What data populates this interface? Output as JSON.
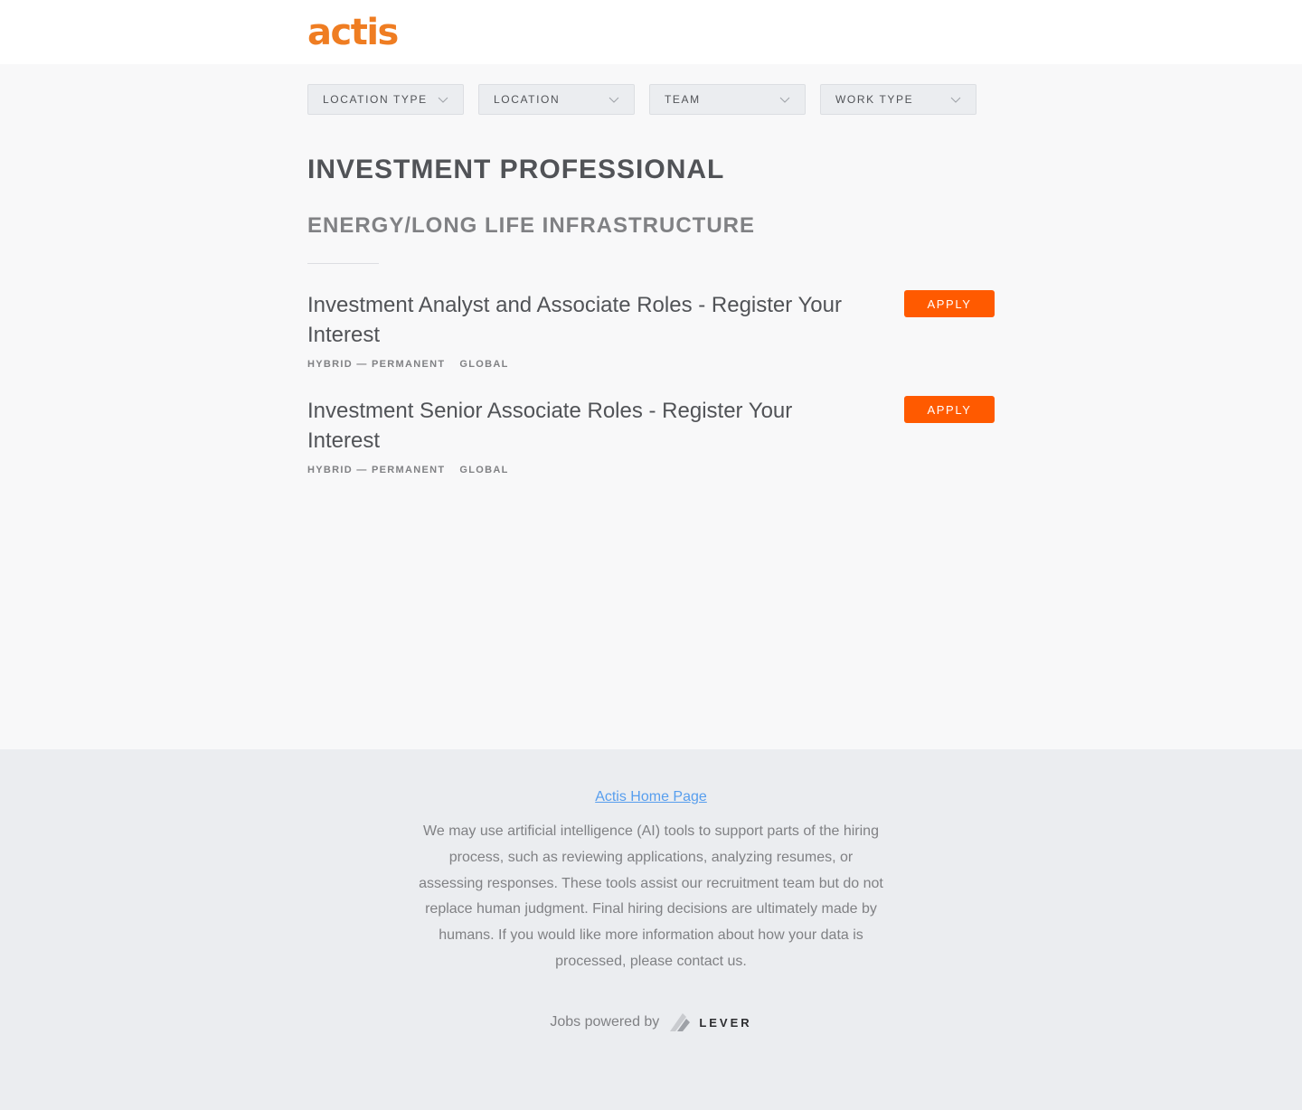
{
  "header": {
    "logo_text": "actis",
    "logo_color": "#ef7d22"
  },
  "filters": [
    {
      "label": "LOCATION TYPE"
    },
    {
      "label": "LOCATION"
    },
    {
      "label": "TEAM"
    },
    {
      "label": "WORK TYPE"
    }
  ],
  "department": "INVESTMENT PROFESSIONAL",
  "team": "ENERGY/LONG LIFE INFRASTRUCTURE",
  "postings": [
    {
      "title": "Investment Analyst and Associate Roles - Register Your Interest",
      "commitment": "HYBRID — PERMANENT",
      "location": "GLOBAL",
      "apply_label": "APPLY"
    },
    {
      "title": "Investment Senior Associate Roles - Register Your Interest",
      "commitment": "HYBRID — PERMANENT",
      "location": "GLOBAL",
      "apply_label": "APPLY"
    }
  ],
  "footer": {
    "home_link": "Actis Home Page",
    "ai_note": "We may use artificial intelligence (AI) tools to support parts of the hiring process, such as reviewing applications, analyzing resumes, or assessing responses. These tools assist our recruitment team but do not replace human judgment. Final hiring decisions are ultimately made by humans. If you would like more information about how your data is processed, please contact us.",
    "powered_by": "Jobs powered by",
    "lever_word": "LEVER"
  },
  "colors": {
    "apply": "#ff5a00",
    "link": "#579eee",
    "accent": "#ef7d22"
  },
  "icons": {
    "filter_chevron": "chevron-down-icon",
    "lever_logo": "lever-logo-icon"
  }
}
